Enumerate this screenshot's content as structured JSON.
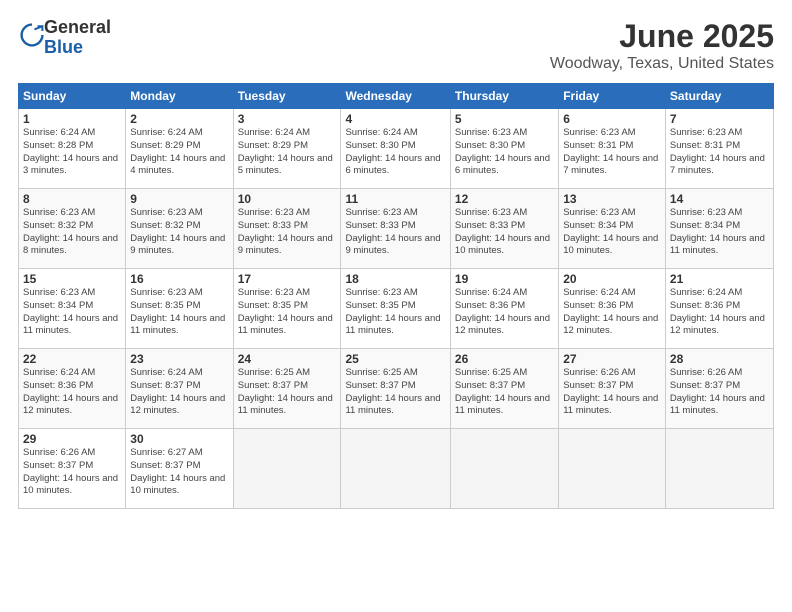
{
  "logo": {
    "general": "General",
    "blue": "Blue"
  },
  "title": "June 2025",
  "subtitle": "Woodway, Texas, United States",
  "weekdays": [
    "Sunday",
    "Monday",
    "Tuesday",
    "Wednesday",
    "Thursday",
    "Friday",
    "Saturday"
  ],
  "weeks": [
    [
      {
        "day": "1",
        "sunrise": "6:24 AM",
        "sunset": "8:28 PM",
        "daylight": "14 hours and 3 minutes."
      },
      {
        "day": "2",
        "sunrise": "6:24 AM",
        "sunset": "8:29 PM",
        "daylight": "14 hours and 4 minutes."
      },
      {
        "day": "3",
        "sunrise": "6:24 AM",
        "sunset": "8:29 PM",
        "daylight": "14 hours and 5 minutes."
      },
      {
        "day": "4",
        "sunrise": "6:24 AM",
        "sunset": "8:30 PM",
        "daylight": "14 hours and 6 minutes."
      },
      {
        "day": "5",
        "sunrise": "6:23 AM",
        "sunset": "8:30 PM",
        "daylight": "14 hours and 6 minutes."
      },
      {
        "day": "6",
        "sunrise": "6:23 AM",
        "sunset": "8:31 PM",
        "daylight": "14 hours and 7 minutes."
      },
      {
        "day": "7",
        "sunrise": "6:23 AM",
        "sunset": "8:31 PM",
        "daylight": "14 hours and 7 minutes."
      }
    ],
    [
      {
        "day": "8",
        "sunrise": "6:23 AM",
        "sunset": "8:32 PM",
        "daylight": "14 hours and 8 minutes."
      },
      {
        "day": "9",
        "sunrise": "6:23 AM",
        "sunset": "8:32 PM",
        "daylight": "14 hours and 9 minutes."
      },
      {
        "day": "10",
        "sunrise": "6:23 AM",
        "sunset": "8:33 PM",
        "daylight": "14 hours and 9 minutes."
      },
      {
        "day": "11",
        "sunrise": "6:23 AM",
        "sunset": "8:33 PM",
        "daylight": "14 hours and 9 minutes."
      },
      {
        "day": "12",
        "sunrise": "6:23 AM",
        "sunset": "8:33 PM",
        "daylight": "14 hours and 10 minutes."
      },
      {
        "day": "13",
        "sunrise": "6:23 AM",
        "sunset": "8:34 PM",
        "daylight": "14 hours and 10 minutes."
      },
      {
        "day": "14",
        "sunrise": "6:23 AM",
        "sunset": "8:34 PM",
        "daylight": "14 hours and 11 minutes."
      }
    ],
    [
      {
        "day": "15",
        "sunrise": "6:23 AM",
        "sunset": "8:34 PM",
        "daylight": "14 hours and 11 minutes."
      },
      {
        "day": "16",
        "sunrise": "6:23 AM",
        "sunset": "8:35 PM",
        "daylight": "14 hours and 11 minutes."
      },
      {
        "day": "17",
        "sunrise": "6:23 AM",
        "sunset": "8:35 PM",
        "daylight": "14 hours and 11 minutes."
      },
      {
        "day": "18",
        "sunrise": "6:23 AM",
        "sunset": "8:35 PM",
        "daylight": "14 hours and 11 minutes."
      },
      {
        "day": "19",
        "sunrise": "6:24 AM",
        "sunset": "8:36 PM",
        "daylight": "14 hours and 12 minutes."
      },
      {
        "day": "20",
        "sunrise": "6:24 AM",
        "sunset": "8:36 PM",
        "daylight": "14 hours and 12 minutes."
      },
      {
        "day": "21",
        "sunrise": "6:24 AM",
        "sunset": "8:36 PM",
        "daylight": "14 hours and 12 minutes."
      }
    ],
    [
      {
        "day": "22",
        "sunrise": "6:24 AM",
        "sunset": "8:36 PM",
        "daylight": "14 hours and 12 minutes."
      },
      {
        "day": "23",
        "sunrise": "6:24 AM",
        "sunset": "8:37 PM",
        "daylight": "14 hours and 12 minutes."
      },
      {
        "day": "24",
        "sunrise": "6:25 AM",
        "sunset": "8:37 PM",
        "daylight": "14 hours and 11 minutes."
      },
      {
        "day": "25",
        "sunrise": "6:25 AM",
        "sunset": "8:37 PM",
        "daylight": "14 hours and 11 minutes."
      },
      {
        "day": "26",
        "sunrise": "6:25 AM",
        "sunset": "8:37 PM",
        "daylight": "14 hours and 11 minutes."
      },
      {
        "day": "27",
        "sunrise": "6:26 AM",
        "sunset": "8:37 PM",
        "daylight": "14 hours and 11 minutes."
      },
      {
        "day": "28",
        "sunrise": "6:26 AM",
        "sunset": "8:37 PM",
        "daylight": "14 hours and 11 minutes."
      }
    ],
    [
      {
        "day": "29",
        "sunrise": "6:26 AM",
        "sunset": "8:37 PM",
        "daylight": "14 hours and 10 minutes."
      },
      {
        "day": "30",
        "sunrise": "6:27 AM",
        "sunset": "8:37 PM",
        "daylight": "14 hours and 10 minutes."
      },
      null,
      null,
      null,
      null,
      null
    ]
  ],
  "labels": {
    "sunrise": "Sunrise:",
    "sunset": "Sunset:",
    "daylight": "Daylight:"
  }
}
